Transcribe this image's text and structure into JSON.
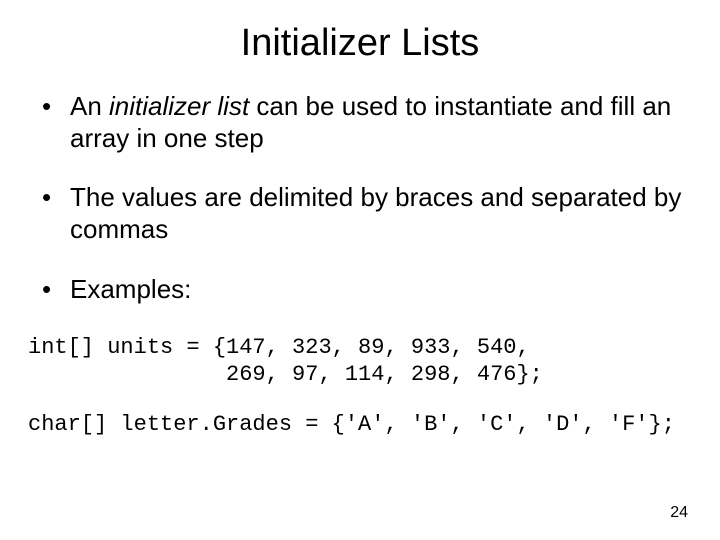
{
  "title": "Initializer Lists",
  "bullets": {
    "b1_pre": "An ",
    "b1_italic": "initializer list",
    "b1_post": " can be used to instantiate and fill an array in one step",
    "b2": "The values are delimited by braces and separated by commas",
    "b3": "Examples:"
  },
  "code": {
    "line1": "int[] units = {147, 323, 89, 933, 540,",
    "line2": "               269, 97, 114, 298, 476};",
    "line3": "char[] letter.Grades = {'A', 'B', 'C', 'D', 'F'};"
  },
  "page_number": "24"
}
